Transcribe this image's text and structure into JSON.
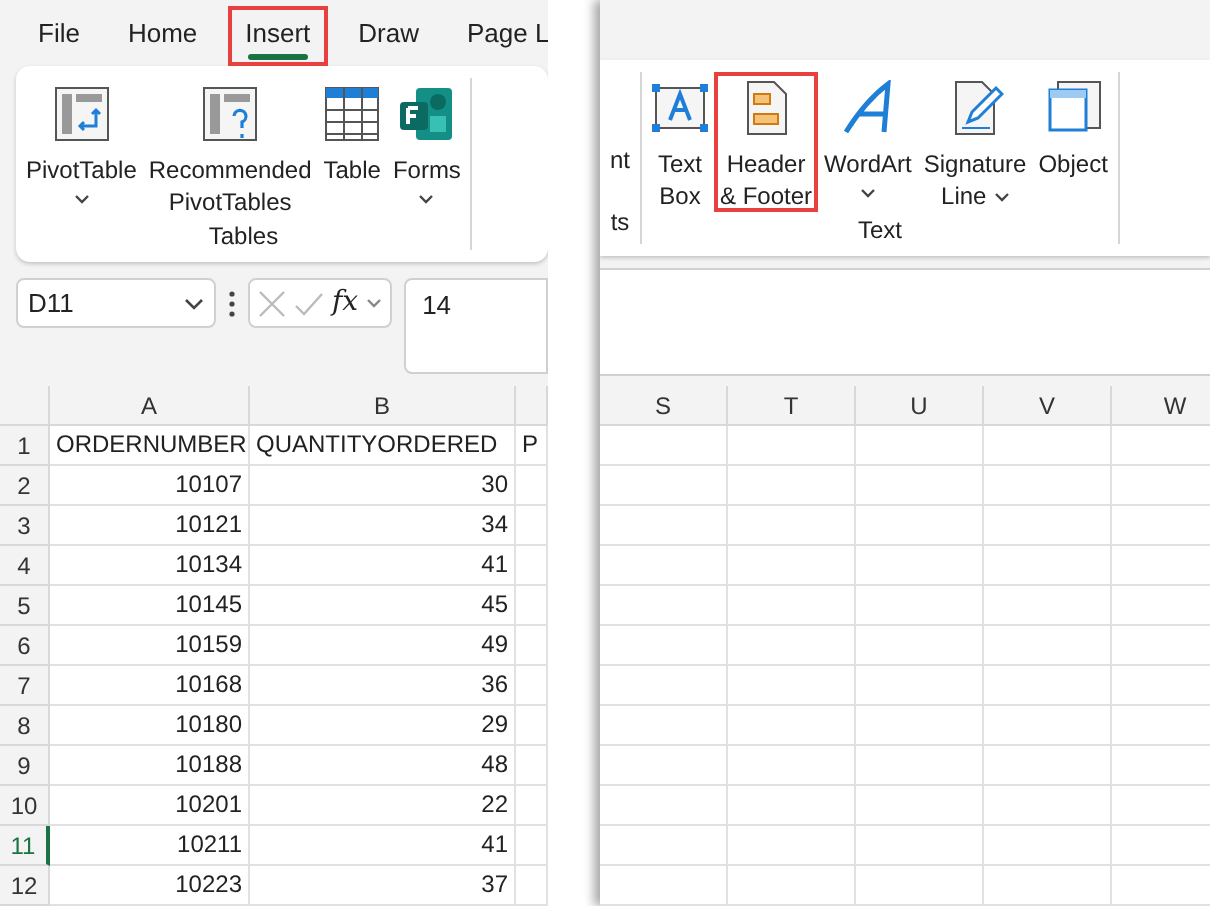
{
  "left": {
    "tabs": [
      {
        "label": "File",
        "selected": false,
        "highlighted": false
      },
      {
        "label": "Home",
        "selected": false,
        "highlighted": false
      },
      {
        "label": "Insert",
        "selected": true,
        "highlighted": true
      },
      {
        "label": "Draw",
        "selected": false,
        "highlighted": false
      },
      {
        "label": "Page L",
        "selected": false,
        "highlighted": false
      }
    ],
    "ribbon_groups": [
      {
        "label": "Tables",
        "commands": [
          {
            "kind": "pivot",
            "lines": [
              "PivotTable"
            ],
            "dropdown": true,
            "highlighted": false
          },
          {
            "kind": "recommended",
            "lines": [
              "Recommended",
              "PivotTables"
            ],
            "dropdown": false,
            "highlighted": false
          },
          {
            "kind": "table",
            "lines": [
              "Table"
            ],
            "dropdown": false,
            "highlighted": false
          },
          {
            "kind": "forms",
            "lines": [
              "Forms"
            ],
            "dropdown": true,
            "highlighted": false
          }
        ]
      }
    ],
    "name_box": "D11",
    "function_label": "fx",
    "formula": "14",
    "columns": [
      "A",
      "B",
      ""
    ],
    "rows": [
      {
        "number": "1",
        "selected": false,
        "cells": [
          "ORDERNUMBER",
          "QUANTITYORDERED",
          "P"
        ]
      },
      {
        "number": "2",
        "selected": false,
        "cells": [
          "10107",
          "30",
          ""
        ]
      },
      {
        "number": "3",
        "selected": false,
        "cells": [
          "10121",
          "34",
          ""
        ]
      },
      {
        "number": "4",
        "selected": false,
        "cells": [
          "10134",
          "41",
          ""
        ]
      },
      {
        "number": "5",
        "selected": false,
        "cells": [
          "10145",
          "45",
          ""
        ]
      },
      {
        "number": "6",
        "selected": false,
        "cells": [
          "10159",
          "49",
          ""
        ]
      },
      {
        "number": "7",
        "selected": false,
        "cells": [
          "10168",
          "36",
          ""
        ]
      },
      {
        "number": "8",
        "selected": false,
        "cells": [
          "10180",
          "29",
          ""
        ]
      },
      {
        "number": "9",
        "selected": false,
        "cells": [
          "10188",
          "48",
          ""
        ]
      },
      {
        "number": "10",
        "selected": false,
        "cells": [
          "10201",
          "22",
          ""
        ]
      },
      {
        "number": "11",
        "selected": true,
        "cells": [
          "10211",
          "41",
          ""
        ]
      },
      {
        "number": "12",
        "selected": false,
        "cells": [
          "10223",
          "37",
          ""
        ]
      }
    ]
  },
  "right": {
    "ribbon_groups": [
      {
        "label": "ts",
        "commands": [
          {
            "kind": "fragment",
            "lines": [
              "nt"
            ],
            "dropdown": false,
            "highlighted": false
          }
        ]
      },
      {
        "label": "Text",
        "commands": [
          {
            "kind": "textbox",
            "lines": [
              "Text",
              "Box"
            ],
            "dropdown": false,
            "highlighted": false
          },
          {
            "kind": "headerfooter",
            "lines": [
              "Header",
              "& Footer"
            ],
            "dropdown": false,
            "highlighted": true
          },
          {
            "kind": "wordart",
            "lines": [
              "WordArt"
            ],
            "dropdown": true,
            "highlighted": false
          },
          {
            "kind": "signature",
            "lines": [
              "Signature",
              "Line"
            ],
            "dropdown": true,
            "highlighted": false
          },
          {
            "kind": "object",
            "lines": [
              "Object"
            ],
            "dropdown": false,
            "highlighted": false
          }
        ]
      }
    ],
    "columns": [
      "S",
      "T",
      "U",
      "V",
      "W"
    ]
  }
}
